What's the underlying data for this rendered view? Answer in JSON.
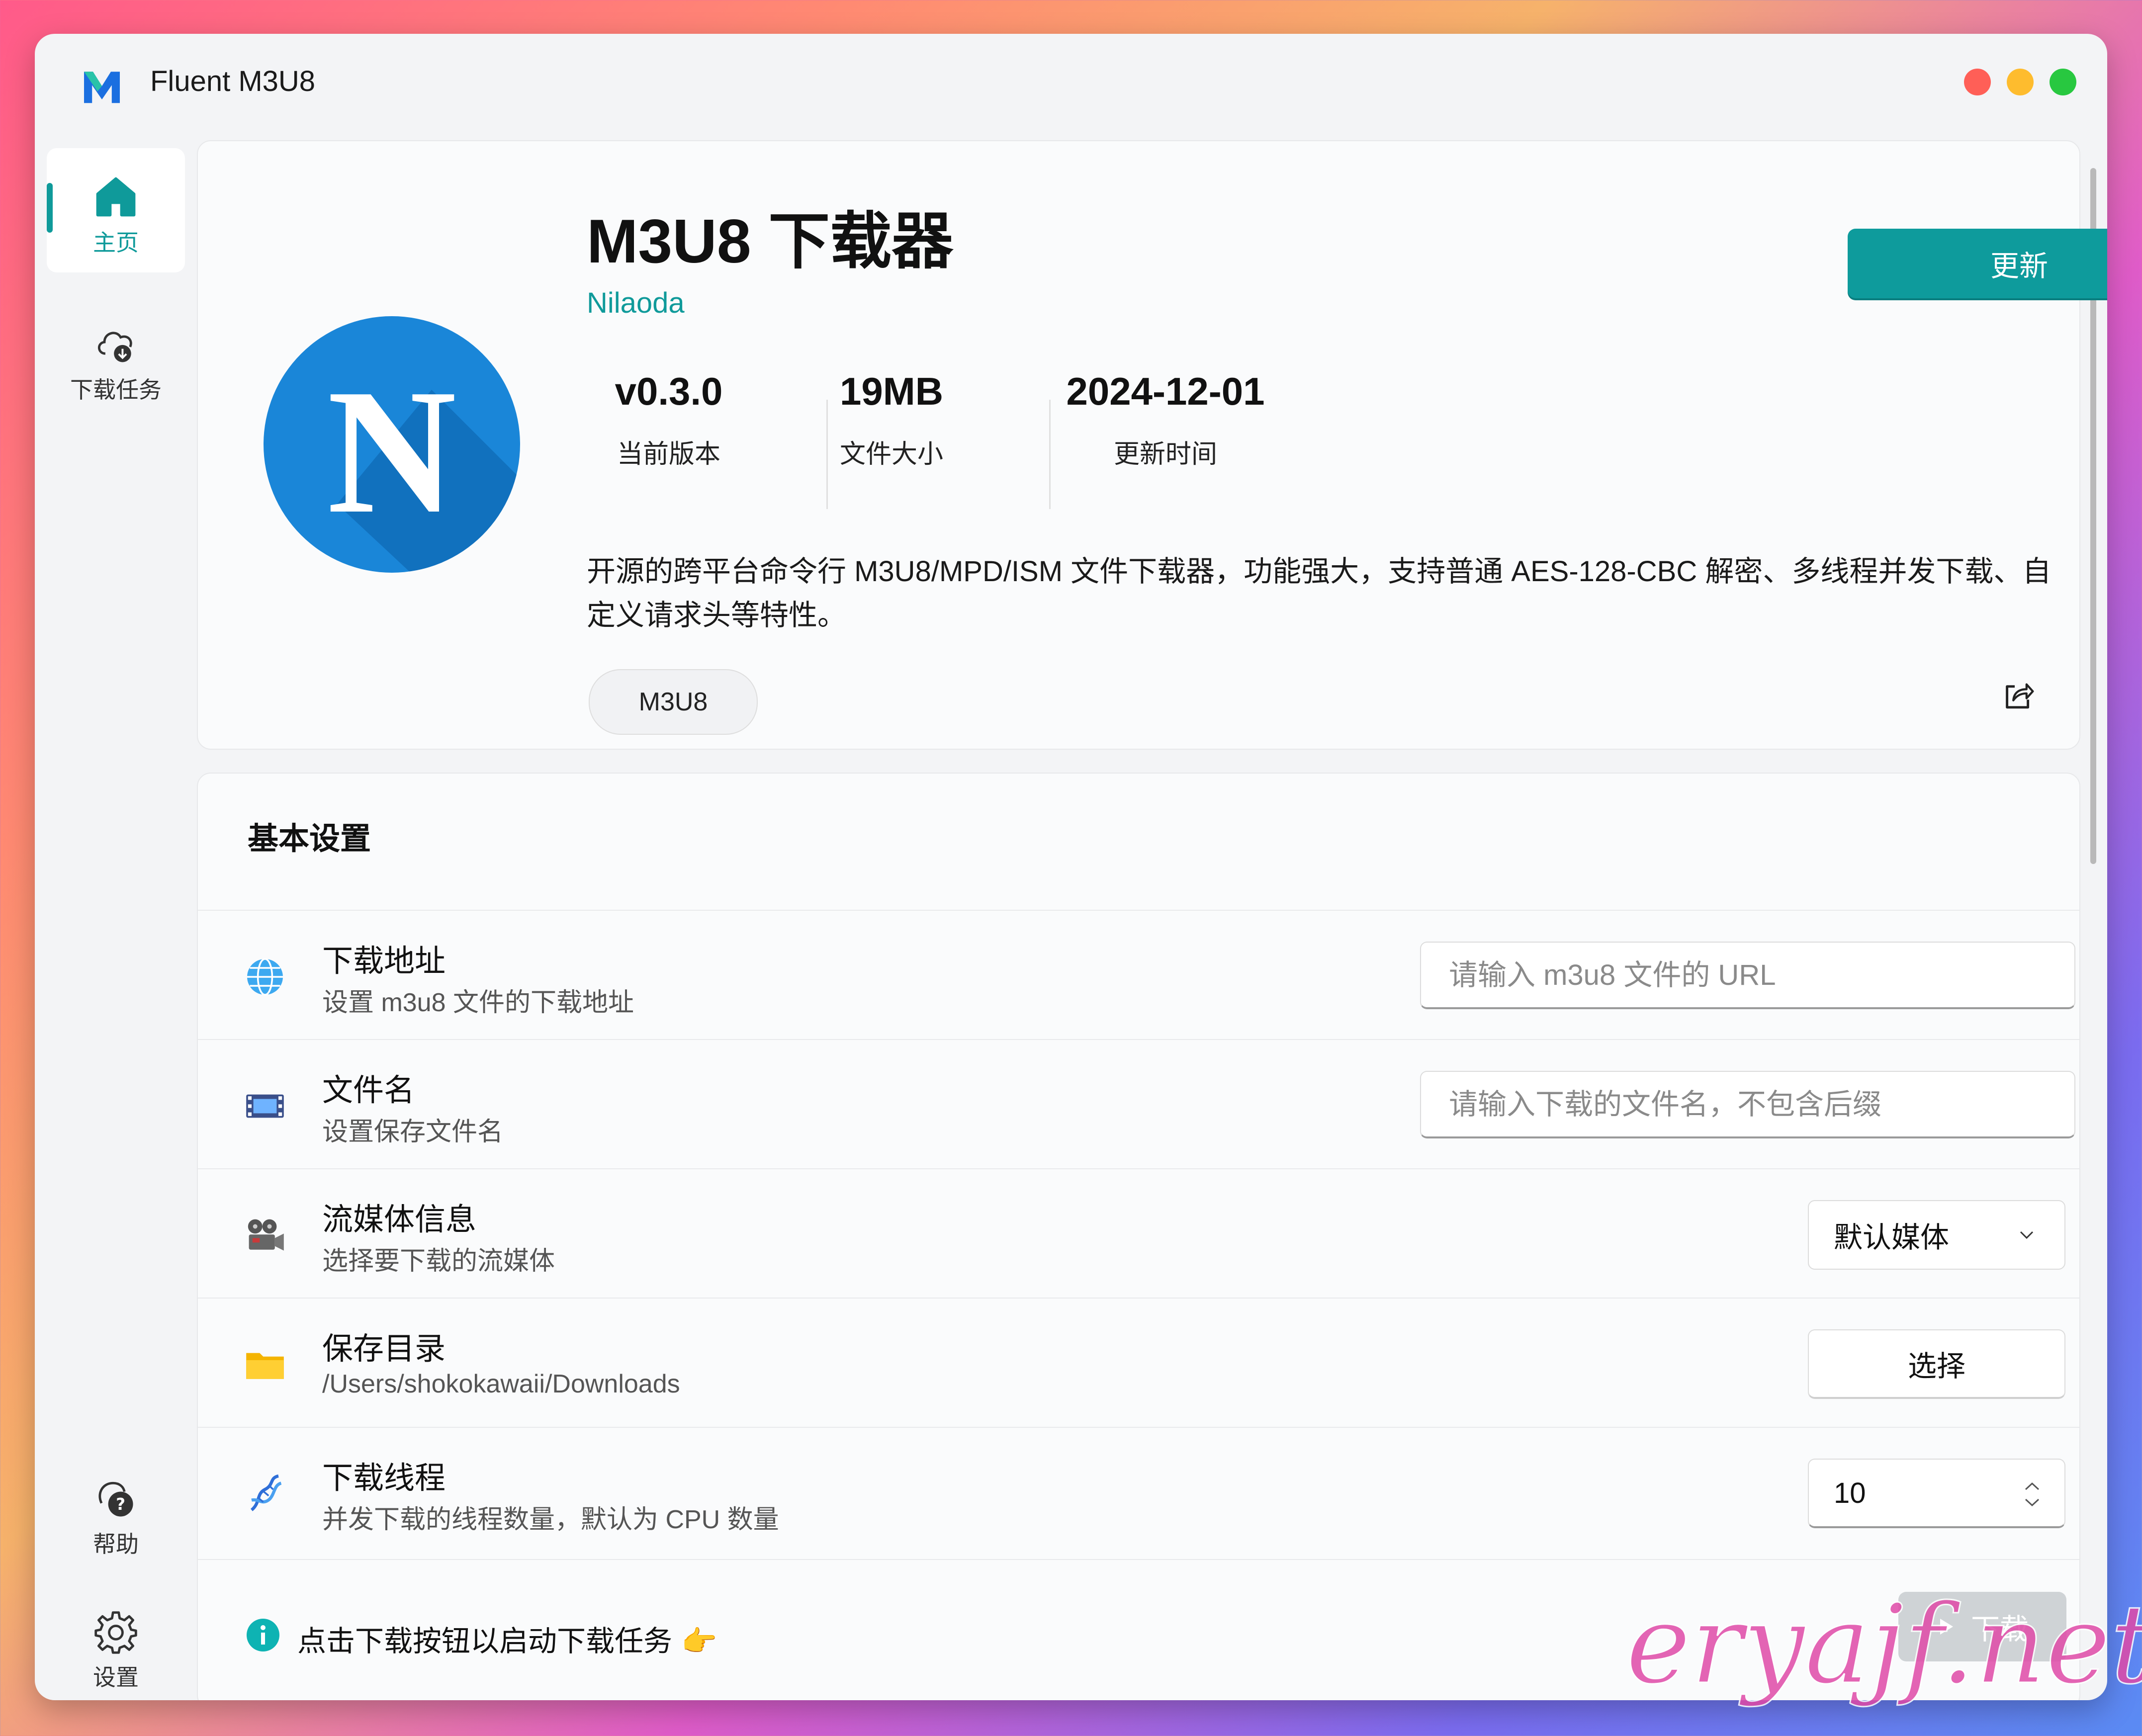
{
  "app": {
    "title": "Fluent M3U8"
  },
  "nav": {
    "home": "主页",
    "download_tasks": "下载任务",
    "help": "帮助",
    "settings": "设置"
  },
  "hero": {
    "logo_letter": "N",
    "title": "M3U8 下载器",
    "author": "Nilaoda",
    "update_button": "更新",
    "stats": [
      {
        "value": "v0.3.0",
        "label": "当前版本"
      },
      {
        "value": "19MB",
        "label": "文件大小"
      },
      {
        "value": "2024-12-01",
        "label": "更新时间"
      }
    ],
    "description": "开源的跨平台命令行 M3U8/MPD/ISM 文件下载器，功能强大，支持普通 AES-128-CBC 解密、多线程并发下载、自定义请求头等特性。",
    "tag": "M3U8"
  },
  "settings": {
    "title": "基本设置",
    "url": {
      "title": "下载地址",
      "subtitle": "设置 m3u8 文件的下载地址",
      "placeholder": "请输入 m3u8 文件的 URL",
      "value": ""
    },
    "filename": {
      "title": "文件名",
      "subtitle": "设置保存文件名",
      "placeholder": "请输入下载的文件名，不包含后缀",
      "value": ""
    },
    "stream": {
      "title": "流媒体信息",
      "subtitle": "选择要下载的流媒体",
      "selected": "默认媒体"
    },
    "save_dir": {
      "title": "保存目录",
      "subtitle": "/Users/shokokawaii/Downloads",
      "button": "选择"
    },
    "threads": {
      "title": "下载线程",
      "subtitle": "并发下载的线程数量，默认为 CPU 数量",
      "value": "10"
    }
  },
  "footer": {
    "info": "点击下载按钮以启动下载任务",
    "hand_icon": "👉",
    "download_button": "下载"
  },
  "watermark": "eryajf.net",
  "colors": {
    "accent": "#0e9b9c",
    "logo_blue": "#1a86d8"
  }
}
